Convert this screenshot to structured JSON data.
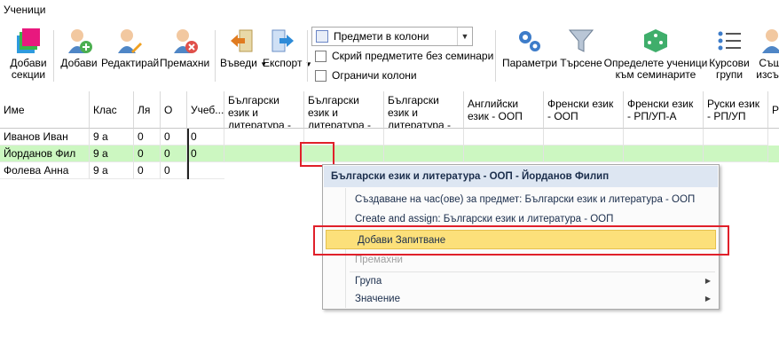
{
  "window": {
    "title": "Ученици"
  },
  "toolbar": {
    "add_sections": "Добави секции",
    "add": "Добави",
    "edit": "Редактирай",
    "remove": "Премахни",
    "import": "Въведи",
    "export": "Експорт",
    "subjects_combo": "Предмети в колони",
    "hide_subjects": "Скрий предметите без семинари",
    "limit_columns": "Ограничи колони",
    "parameters": "Параметри",
    "search": "Търсене",
    "assign_seminars": "Определете ученици към семинарите",
    "course_groups": "Курсови групи",
    "existing": "Същ. изсъщ"
  },
  "grid": {
    "columns": [
      "Име",
      "Клас",
      "Ля",
      "О",
      "Учеб...",
      "Български език и литература -",
      "Български език и литература -",
      "Български език и литература -",
      "Английски език - ООП",
      "Френски език - ООП",
      "Френски език - РП/УП-А",
      "Руски език - РП/УП",
      "Ру..."
    ],
    "rows": [
      {
        "name": "Иванов Иван",
        "class": "9 а",
        "la": "0",
        "o": "0",
        "ucheb": "0"
      },
      {
        "name": "Йорданов Фил",
        "class": "9 а",
        "la": "0",
        "o": "0",
        "ucheb": "0"
      },
      {
        "name": "Фолева Анна",
        "class": "9 а",
        "la": "0",
        "o": "0",
        "ucheb": "0"
      }
    ]
  },
  "context_menu": {
    "header": "Български език и литература - ООП - Йорданов Филип",
    "create_lessons": "Създаване на час(ове) за предмет: Български език и литература - ООП",
    "create_assign": "Create and assign:  Български език и литература - ООП",
    "add_question": "Добави Запитване",
    "remove": "Премахни",
    "group": "Група",
    "value": "Значение"
  },
  "colors": {
    "selected_row": "#ccf7c1",
    "highlight": "#fce07a",
    "annotation": "#e0202a"
  }
}
